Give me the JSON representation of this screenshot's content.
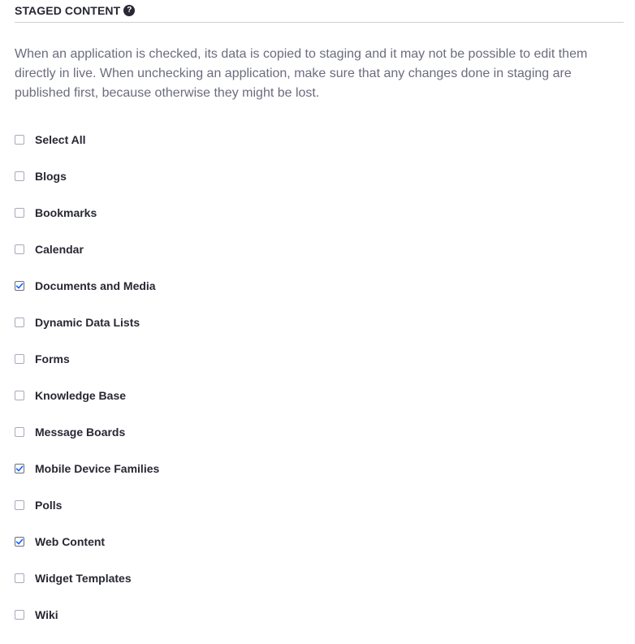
{
  "section": {
    "title": "STAGED CONTENT",
    "help_glyph": "?"
  },
  "description": "When an application is checked, its data is copied to staging and it may not be possible to edit them directly in live. When unchecking an application, make sure that any changes done in staging are published first, because otherwise they might be lost.",
  "apps": [
    {
      "label": "Select All",
      "checked": false,
      "name": "select-all"
    },
    {
      "label": "Blogs",
      "checked": false,
      "name": "blogs"
    },
    {
      "label": "Bookmarks",
      "checked": false,
      "name": "bookmarks"
    },
    {
      "label": "Calendar",
      "checked": false,
      "name": "calendar"
    },
    {
      "label": "Documents and Media",
      "checked": true,
      "name": "documents-and-media"
    },
    {
      "label": "Dynamic Data Lists",
      "checked": false,
      "name": "dynamic-data-lists"
    },
    {
      "label": "Forms",
      "checked": false,
      "name": "forms"
    },
    {
      "label": "Knowledge Base",
      "checked": false,
      "name": "knowledge-base"
    },
    {
      "label": "Message Boards",
      "checked": false,
      "name": "message-boards"
    },
    {
      "label": "Mobile Device Families",
      "checked": true,
      "name": "mobile-device-families"
    },
    {
      "label": "Polls",
      "checked": false,
      "name": "polls"
    },
    {
      "label": "Web Content",
      "checked": true,
      "name": "web-content"
    },
    {
      "label": "Widget Templates",
      "checked": false,
      "name": "widget-templates"
    },
    {
      "label": "Wiki",
      "checked": false,
      "name": "wiki"
    }
  ],
  "colors": {
    "check_accent": "#0b5fff",
    "text_primary": "#272833",
    "text_secondary": "#6b6c7e",
    "divider": "#cdced9"
  }
}
